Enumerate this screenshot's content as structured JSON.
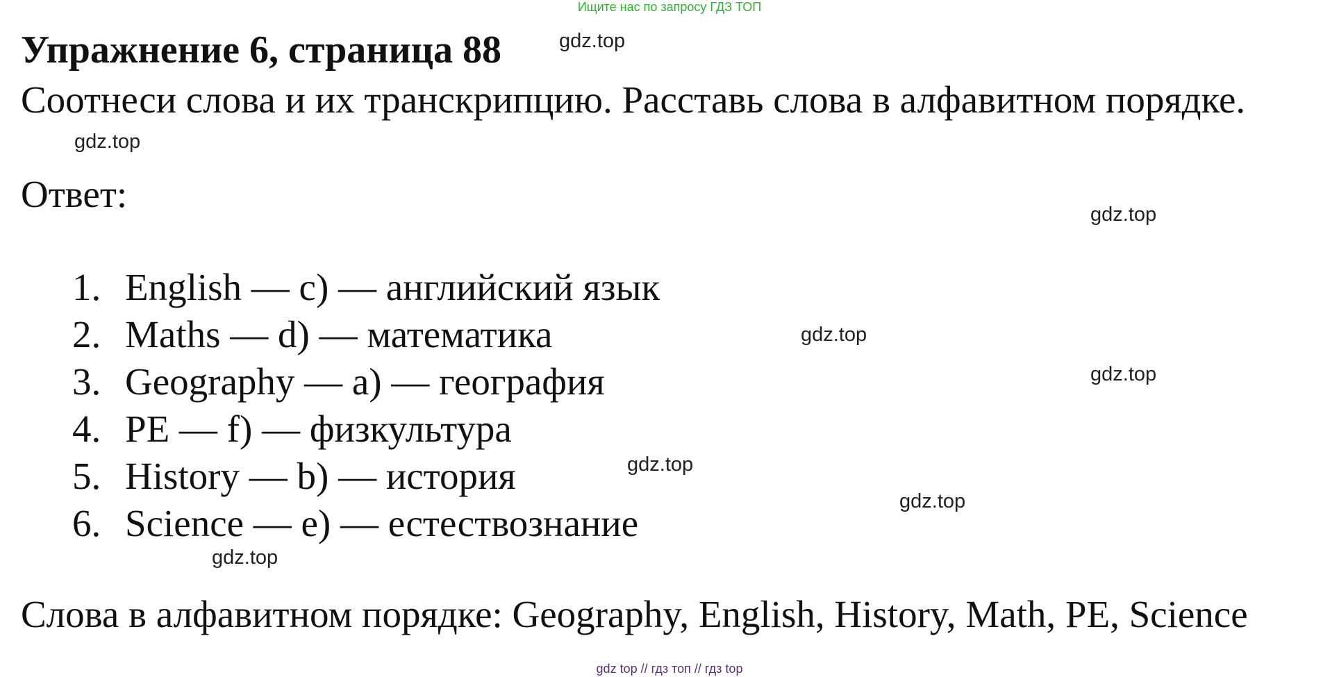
{
  "banner": "Ищите нас по запросу ГДЗ ТОП",
  "title": "Упражнение 6, страница 88",
  "task": "Соотнеси слова и их транскрипцию. Расставь слова в алфавитном порядке.",
  "answer_label": "Ответ:",
  "answers": [
    {
      "num": "1.",
      "text": "English — c) — английский язык"
    },
    {
      "num": "2.",
      "text": "Maths — d) — математика"
    },
    {
      "num": "3.",
      "text": "Geography — a) — география"
    },
    {
      "num": "4.",
      "text": "PE — f) — физкультура"
    },
    {
      "num": "5.",
      "text": "History — b) — история"
    },
    {
      "num": "6.",
      "text": "Science — e) — естествознание"
    }
  ],
  "alphabetical": "Слова в алфавитном порядке: Geography, English, History, Math, PE, Science",
  "watermark": "gdz.top",
  "footer": "gdz top  //  гдз топ  //  гдз top",
  "colors": {
    "banner": "#2db42d",
    "footer": "#5a2d82",
    "text": "#111111"
  }
}
